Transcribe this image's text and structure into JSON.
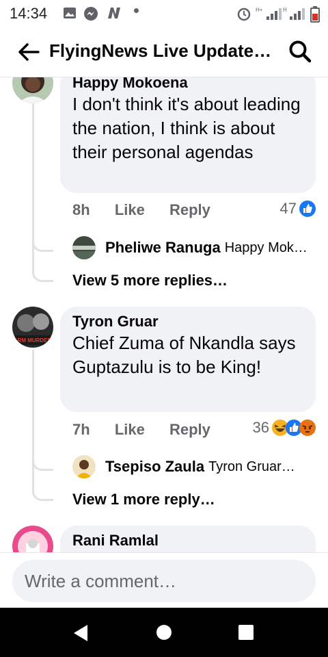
{
  "status_bar": {
    "time": "14:34"
  },
  "header": {
    "title": "FlyingNews Live Update…"
  },
  "comments": [
    {
      "author": "Happy Mokoena",
      "text": "I don't think it's about leading the nation, I think is about their personal agendas",
      "time": "8h",
      "like": "Like",
      "reply": "Reply",
      "reaction_count": "47",
      "top_reply": {
        "author": "Pheliwe Ranuga",
        "preview": "Happy Mok…"
      },
      "more_replies": "View 5 more replies…"
    },
    {
      "author": "Tyron Gruar",
      "text": "Chief Zuma of Nkandla says Guptazulu is to be King!",
      "time": "7h",
      "like": "Like",
      "reply": "Reply",
      "reaction_count": "36",
      "avatar_text": "FARM MURDERS",
      "top_reply": {
        "author": "Tsepiso Zaula",
        "preview": "Tyron Gruar G…"
      },
      "more_replies": "View 1 more reply…"
    },
    {
      "author": "Rani Ramlal"
    }
  ],
  "composer": {
    "placeholder": "Write a comment…"
  },
  "colors": {
    "like_blue": "#1877f2",
    "bubble": "#f0f2f5",
    "meta_gray": "#65676b",
    "angry": "#e9710f",
    "haha": "#f7b125"
  },
  "icons": [
    "back-arrow-icon",
    "search-icon",
    "like-reaction-icon",
    "haha-reaction-icon",
    "angry-reaction-icon",
    "nav-back-icon",
    "nav-home-icon",
    "nav-recents-icon"
  ]
}
